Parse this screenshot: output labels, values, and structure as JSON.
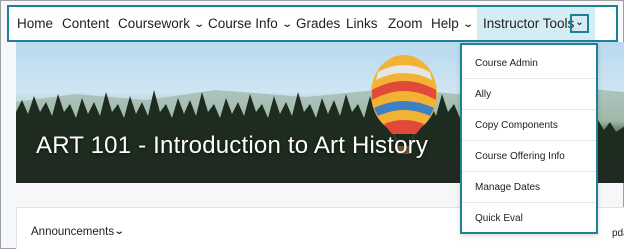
{
  "nav": {
    "items": [
      {
        "label": "Home",
        "dropdown": false
      },
      {
        "label": "Content",
        "dropdown": false
      },
      {
        "label": "Coursework",
        "dropdown": true
      },
      {
        "label": "Course Info",
        "dropdown": true
      },
      {
        "label": "Grades",
        "dropdown": false
      },
      {
        "label": "Links",
        "dropdown": false
      },
      {
        "label": "Zoom",
        "dropdown": false
      },
      {
        "label": "Help",
        "dropdown": true
      }
    ],
    "instructor_tools": {
      "label": "Instructor Tools",
      "active": true
    }
  },
  "banner": {
    "title": "ART 101 - Introduction to Art History"
  },
  "dropdown_menu": {
    "items": [
      {
        "label": "Course Admin"
      },
      {
        "label": "Ally"
      },
      {
        "label": "Copy Components"
      },
      {
        "label": "Course Offering Info"
      },
      {
        "label": "Manage Dates"
      },
      {
        "label": "Quick Eval"
      }
    ]
  },
  "widgets": {
    "announcements_label": "Announcements",
    "truncated_right_label": "pdate"
  },
  "colors": {
    "accent_border": "#1f7f93",
    "active_tab_bg": "#d4edf5",
    "text": "#202122"
  },
  "icons": {
    "dropdown_chevron": "chevron-down-icon"
  }
}
